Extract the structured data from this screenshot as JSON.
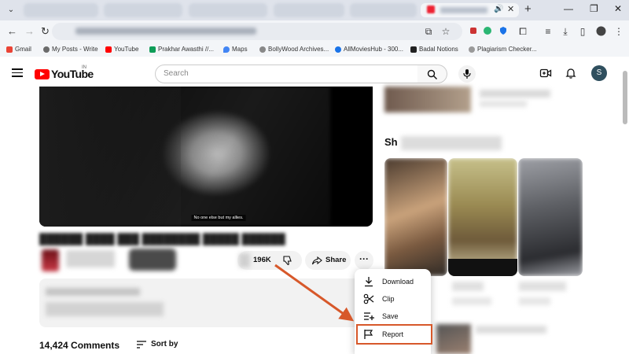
{
  "browser": {
    "bookmarks": [
      {
        "label": "Gmail",
        "color": "#ea4335"
      },
      {
        "label": "My Posts - Write",
        "color": "#6b6b6b"
      },
      {
        "label": "YouTube",
        "color": "#ff0000"
      },
      {
        "label": "Prakhar Awasthi //...",
        "color": "#0f9d58"
      },
      {
        "label": "Maps",
        "color": "#4285f4"
      },
      {
        "label": "BollyWood Archives...",
        "color": "#888888"
      },
      {
        "label": "AllMoviesHub - 300...",
        "color": "#1a73e8"
      },
      {
        "label": "Badal Notions",
        "color": "#222222"
      },
      {
        "label": "Plagiarism Checker...",
        "color": "#999999"
      }
    ]
  },
  "youtube": {
    "logo_text": "YouTube",
    "country_code": "IN",
    "search_placeholder": "Search",
    "avatar_letter": "S",
    "brand_color": "#ff0000"
  },
  "video": {
    "subtitle": "No one else but my allies."
  },
  "actions": {
    "like_count": "196K",
    "share_label": "Share",
    "more_label": "···"
  },
  "menu": {
    "items": [
      {
        "label": "Download",
        "icon": "download-icon"
      },
      {
        "label": "Clip",
        "icon": "scissors-icon"
      },
      {
        "label": "Save",
        "icon": "playlist-add-icon"
      },
      {
        "label": "Report",
        "icon": "flag-icon"
      }
    ],
    "highlight_color": "#d7582a"
  },
  "comments": {
    "count_label": "14,424 Comments",
    "sort_label": "Sort by"
  },
  "sidebar": {
    "shorts_label": "Sh"
  }
}
